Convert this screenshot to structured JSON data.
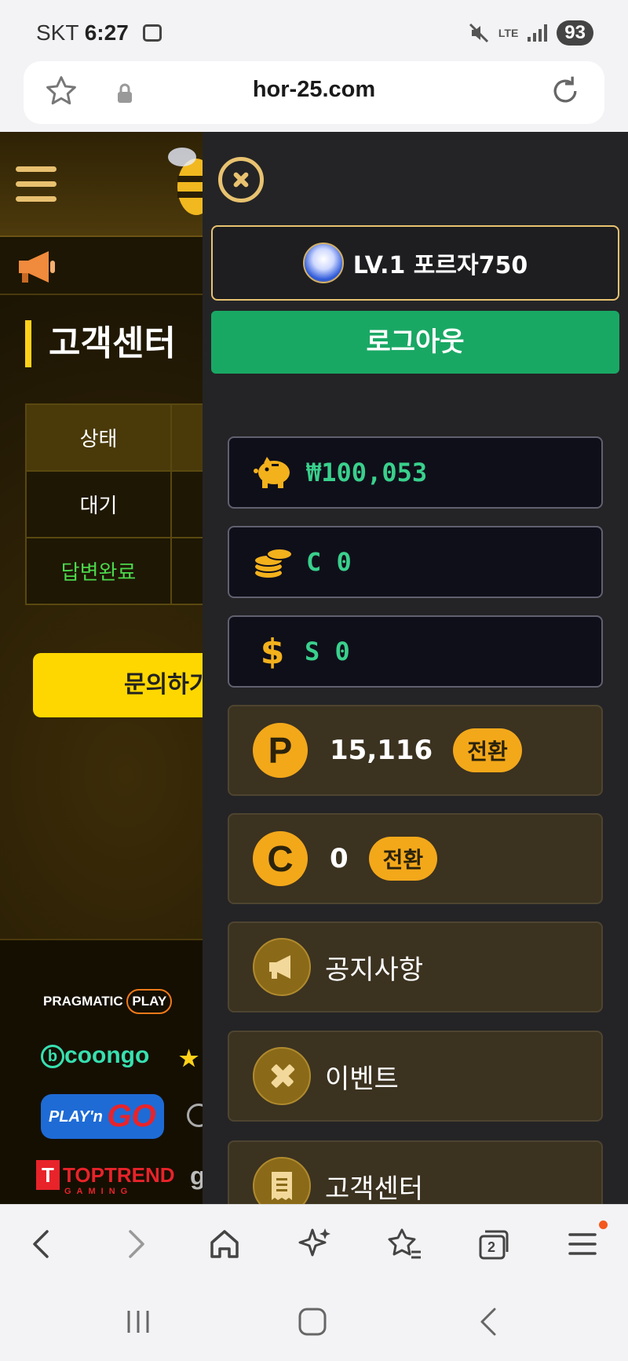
{
  "status_bar": {
    "carrier": "SKT",
    "time": "6:27",
    "network": "LTE",
    "battery": "93"
  },
  "browser": {
    "url": "hor-25.com",
    "tab_count": "2"
  },
  "site": {
    "section_title": "고객센터",
    "table": {
      "header": "상태",
      "rows": [
        "대기",
        "답변완료"
      ]
    },
    "inquiry_button": "문의하기",
    "providers": [
      "PRAGMATIC PLAY",
      "bcoongo",
      "PLAY'n GO",
      "TOPTREND GAMING"
    ]
  },
  "drawer": {
    "user_label": "LV.1 포르자750",
    "logout_label": "로그아웃",
    "wallets": [
      {
        "icon": "piggy-bank-icon",
        "value": "₩100,053"
      },
      {
        "icon": "coins-icon",
        "value": "C 0"
      },
      {
        "icon": "dollar-icon",
        "value": "S 0"
      }
    ],
    "points": {
      "icon_letter": "P",
      "value": "15,116",
      "button": "전환"
    },
    "coins": {
      "icon_letter": "C",
      "value": "0",
      "button": "전환"
    },
    "menu": [
      {
        "icon": "megaphone-icon",
        "label": "공지사항"
      },
      {
        "icon": "event-icon",
        "label": "이벤트"
      },
      {
        "icon": "support-icon",
        "label": "고객센터"
      }
    ]
  },
  "colors": {
    "accent_gold": "#e8c270",
    "logout_green": "#19a864",
    "value_green": "#39d08c",
    "coin_orange": "#f3a81a"
  }
}
